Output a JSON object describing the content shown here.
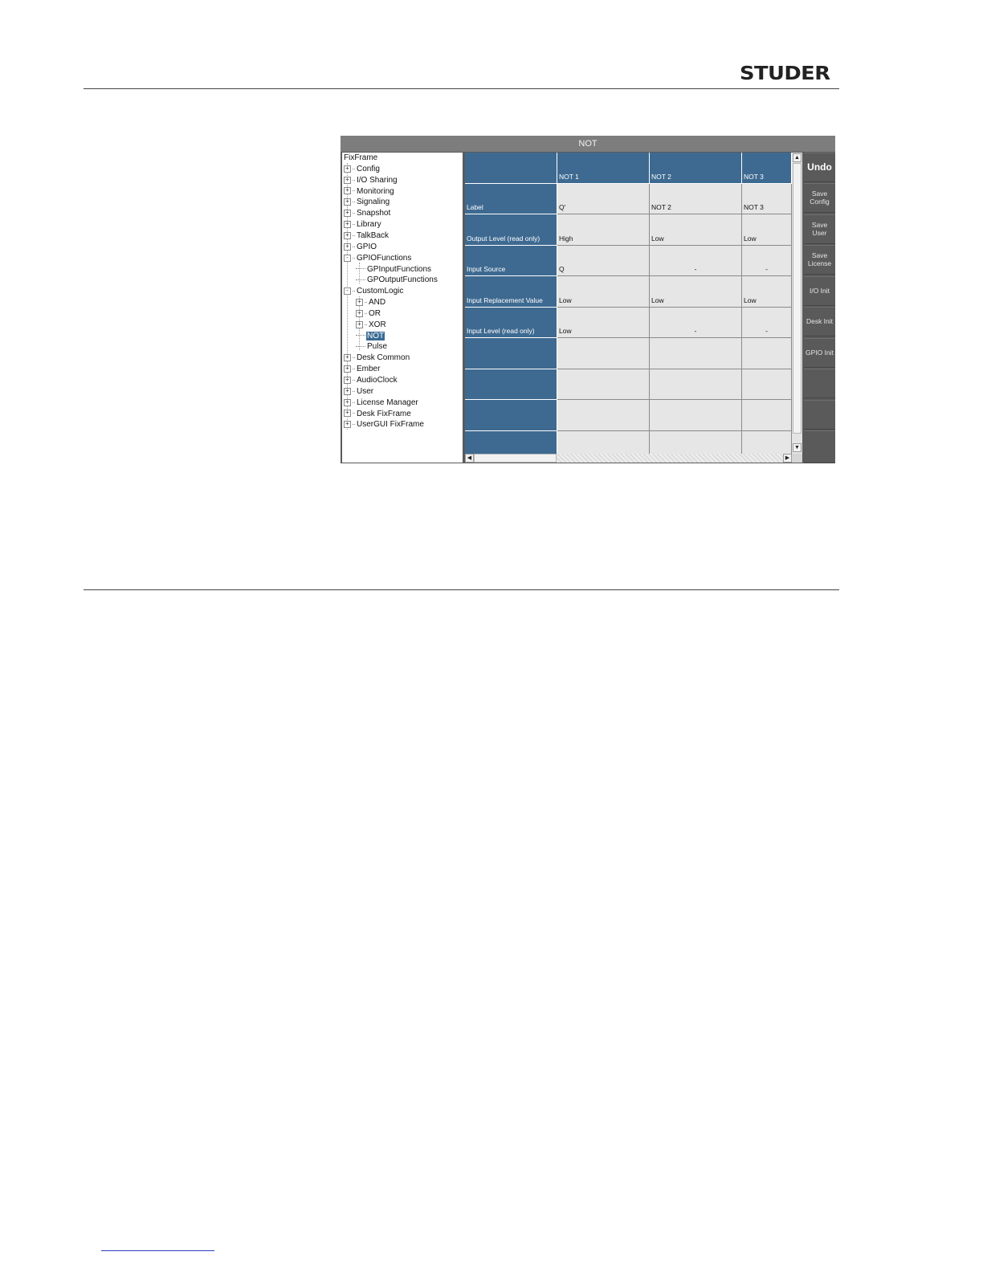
{
  "brand": {
    "logo_text": "STUDER"
  },
  "window": {
    "title": "NOT"
  },
  "tree": {
    "items": [
      {
        "label": "FixFrame",
        "level": 0,
        "expander": ""
      },
      {
        "label": "Config",
        "level": 1,
        "expander": "+"
      },
      {
        "label": "I/O Sharing",
        "level": 1,
        "expander": "+"
      },
      {
        "label": "Monitoring",
        "level": 1,
        "expander": "+"
      },
      {
        "label": "Signaling",
        "level": 1,
        "expander": "+"
      },
      {
        "label": "Snapshot",
        "level": 1,
        "expander": "+"
      },
      {
        "label": "Library",
        "level": 1,
        "expander": "+"
      },
      {
        "label": "TalkBack",
        "level": 1,
        "expander": "+"
      },
      {
        "label": "GPIO",
        "level": 1,
        "expander": "+"
      },
      {
        "label": "GPIOFunctions",
        "level": 1,
        "expander": "-"
      },
      {
        "label": "GPInputFunctions",
        "level": 2,
        "expander": ""
      },
      {
        "label": "GPOutputFunctions",
        "level": 2,
        "expander": ""
      },
      {
        "label": "CustomLogic",
        "level": 1,
        "expander": "-"
      },
      {
        "label": "AND",
        "level": 2,
        "expander": "+"
      },
      {
        "label": "OR",
        "level": 2,
        "expander": "+"
      },
      {
        "label": "XOR",
        "level": 2,
        "expander": "+"
      },
      {
        "label": "NOT",
        "level": 2,
        "expander": "",
        "selected": true
      },
      {
        "label": "Pulse",
        "level": 2,
        "expander": ""
      },
      {
        "label": "Desk Common",
        "level": 1,
        "expander": "+"
      },
      {
        "label": "Ember",
        "level": 1,
        "expander": "+"
      },
      {
        "label": "AudioClock",
        "level": 1,
        "expander": "+"
      },
      {
        "label": "User",
        "level": 1,
        "expander": "+"
      },
      {
        "label": "License Manager",
        "level": 1,
        "expander": "+"
      },
      {
        "label": "Desk FixFrame",
        "level": 1,
        "expander": "+"
      },
      {
        "label": "UserGUI FixFrame",
        "level": 1,
        "expander": "+"
      }
    ]
  },
  "table": {
    "columns": [
      "NOT 1",
      "NOT 2",
      "NOT 3"
    ],
    "rows": [
      {
        "label": "Label",
        "values": [
          "Q'",
          "NOT 2",
          "NOT 3"
        ]
      },
      {
        "label": "Output Level (read only)",
        "values": [
          "High",
          "Low",
          "Low"
        ]
      },
      {
        "label": "Input Source",
        "values": [
          "Q",
          "-",
          "-"
        ]
      },
      {
        "label": "Input Replacement Value",
        "values": [
          "Low",
          "Low",
          "Low"
        ]
      },
      {
        "label": "Input Level (read only)",
        "values": [
          "Low",
          "-",
          "-"
        ]
      },
      {
        "label": "",
        "values": [
          "",
          "",
          ""
        ]
      },
      {
        "label": "",
        "values": [
          "",
          "",
          ""
        ]
      },
      {
        "label": "",
        "values": [
          "",
          "",
          ""
        ]
      },
      {
        "label": "",
        "values": [
          "",
          "",
          ""
        ]
      }
    ]
  },
  "buttons": {
    "undo": "Undo",
    "save_config": "Save Config",
    "save_user": "Save User",
    "save_license": "Save License",
    "io_init": "I/O Init",
    "desk_init": "Desk Init",
    "gpio_init": "GPIO Init"
  },
  "icons": {
    "scroll_up": "▲",
    "scroll_down": "▼",
    "scroll_left": "◀",
    "scroll_right": "▶"
  }
}
